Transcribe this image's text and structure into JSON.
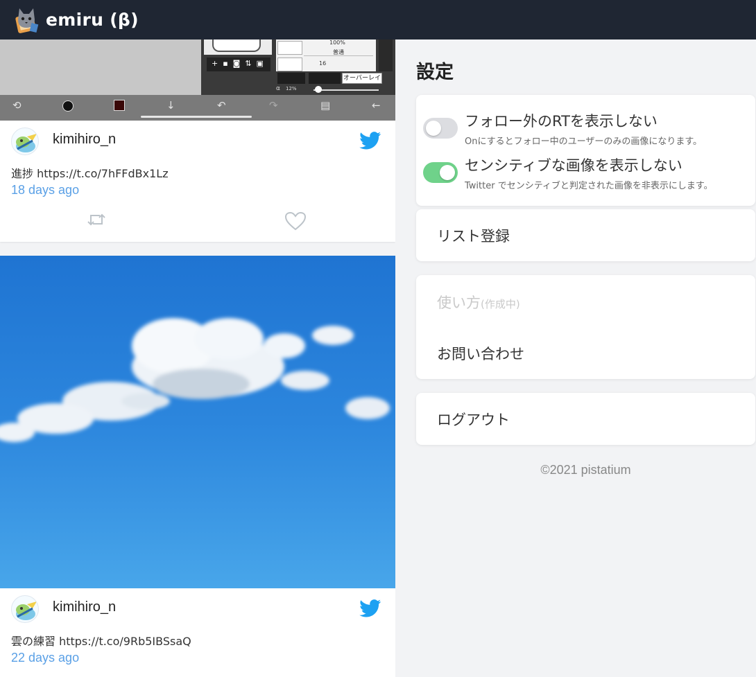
{
  "app": {
    "title": "emiru (β)"
  },
  "feed": {
    "tweets": [
      {
        "user": "kimihiro_n",
        "text": "進捗 https://t.co/7hFFdBx1Lz",
        "time": "18 days ago"
      },
      {
        "user": "kimihiro_n",
        "text": "雲の練習 https://t.co/9Rb5IBSsaQ",
        "time": "22 days ago"
      }
    ],
    "screenshot": {
      "percent": "100%",
      "mode": "普通",
      "size": "16",
      "overlay": "オーバーレイ",
      "alpha": "12%"
    }
  },
  "settings": {
    "title": "設定",
    "toggles": [
      {
        "label": "フォロー外のRTを表示しない",
        "description": "Onにするとフォロー中のユーザーのみの画像になります。",
        "on": false
      },
      {
        "label": "センシティブな画像を表示しない",
        "description": "Twitter でセンシティブと判定された画像を非表示にします。",
        "on": true
      }
    ],
    "list_register": "リスト登録",
    "how_to": "使い方",
    "how_to_note": "(作成中)",
    "contact": "お問い合わせ",
    "logout": "ログアウト",
    "footer": "©2021 pistatium"
  },
  "colors": {
    "header": "#1f2633",
    "toggle_on": "#6fd28a",
    "toggle_off": "#dcdde1",
    "link": "#5aa0e6",
    "twitter": "#1da1f2"
  }
}
